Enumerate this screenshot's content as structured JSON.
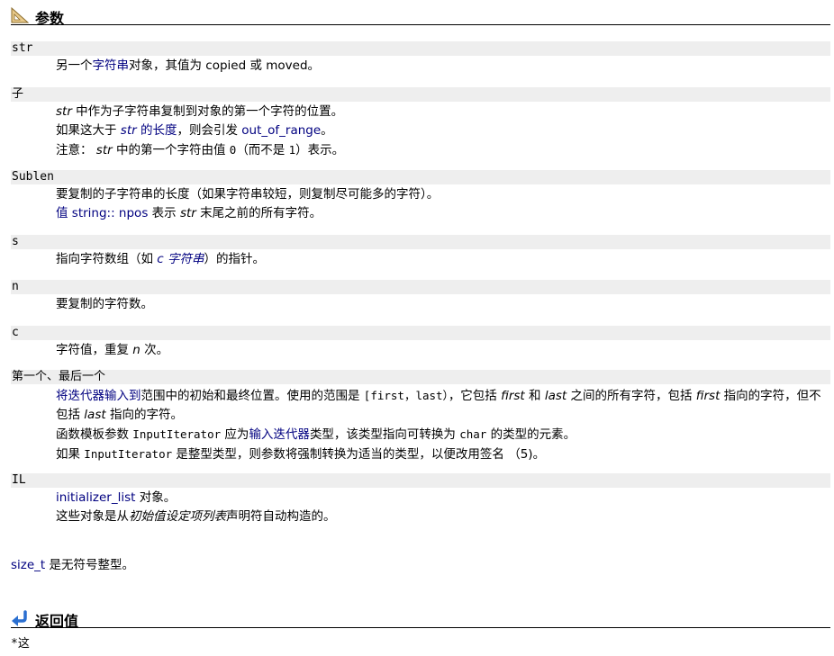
{
  "parameters_section": {
    "title": "参数"
  },
  "params": {
    "str": {
      "name": "str",
      "l1a": "另一个",
      "l1b": "字符串",
      "l1c": "对象，其值为 copied 或 moved。"
    },
    "pos": {
      "name": "子",
      "l1a": "str",
      "l1b": " 中作为子字符串复制到对象的第一个字符的位置。",
      "l2a": "如果这大于 ",
      "l2b": "str",
      "l2c": " 的长度",
      "l2d": "，则会引发 ",
      "l2e": "out_of_range",
      "l2f": "。",
      "l3a": "注意： ",
      "l3b": "str",
      "l3c": " 中的第一个字符由值 ",
      "l3d": "0",
      "l3e": "（而不是 ",
      "l3f": "1",
      "l3g": "）表示。"
    },
    "sublen": {
      "name": "Sublen",
      "l1": "要复制的子字符串的长度（如果字符串较短，则复制尽可能多的字符）。",
      "l2a": "值 string:: npos",
      "l2b": " 表示 ",
      "l2c": "str",
      "l2d": " 末尾之前的所有字符。"
    },
    "s": {
      "name": "s",
      "l1a": "指向字符数组（如 ",
      "l1b": "c 字符串",
      "l1c": "）的指针。"
    },
    "n": {
      "name": "n",
      "l1": "要复制的字符数。"
    },
    "c": {
      "name": "c",
      "l1a": "字符值，重复 ",
      "l1b": "n",
      "l1c": " 次。"
    },
    "range": {
      "name": "第一个、最后一个",
      "l1a": "将迭代器输入到",
      "l1b": "范围中的初始和最终位置。使用的范围是 ",
      "l1c": "[first，last）",
      "l1d": "，它包括 ",
      "l1e": "first",
      "l1f": " 和 ",
      "l1g": "last",
      "l1h": " 之间的所有字符，包括 ",
      "l1i": "first",
      "l1j": " 指向的字符，但不包括 ",
      "l1k": "last",
      "l1l": " 指向的字符。",
      "l2a": "函数模板参数 ",
      "l2b": "InputIterator",
      "l2c": " 应为",
      "l2d": "输入迭代器",
      "l2e": "类型，该类型指向可转换为 ",
      "l2f": "char",
      "l2g": " 的类型的元素。",
      "l3a": "如果 ",
      "l3b": "InputIterator",
      "l3c": " 是整型类型，则参数将强制转换为适当的类型，以便改用签名 （5)。"
    },
    "il": {
      "name": "IL",
      "l1a": "initializer_list",
      "l1b": " 对象。",
      "l2a": "这些对象是从",
      "l2b": "初始值设定项列表",
      "l2c": "声明符自动构造的。"
    }
  },
  "size_note": {
    "a": "size_t",
    "b": " 是无符号整型。"
  },
  "return_section": {
    "title": "返回值",
    "text": "*这"
  },
  "colors": {
    "link": "#000080",
    "param_bg": "#eeeeee",
    "icon_blue": "#2a6fd0",
    "icon_tan": "#d9b36a"
  }
}
